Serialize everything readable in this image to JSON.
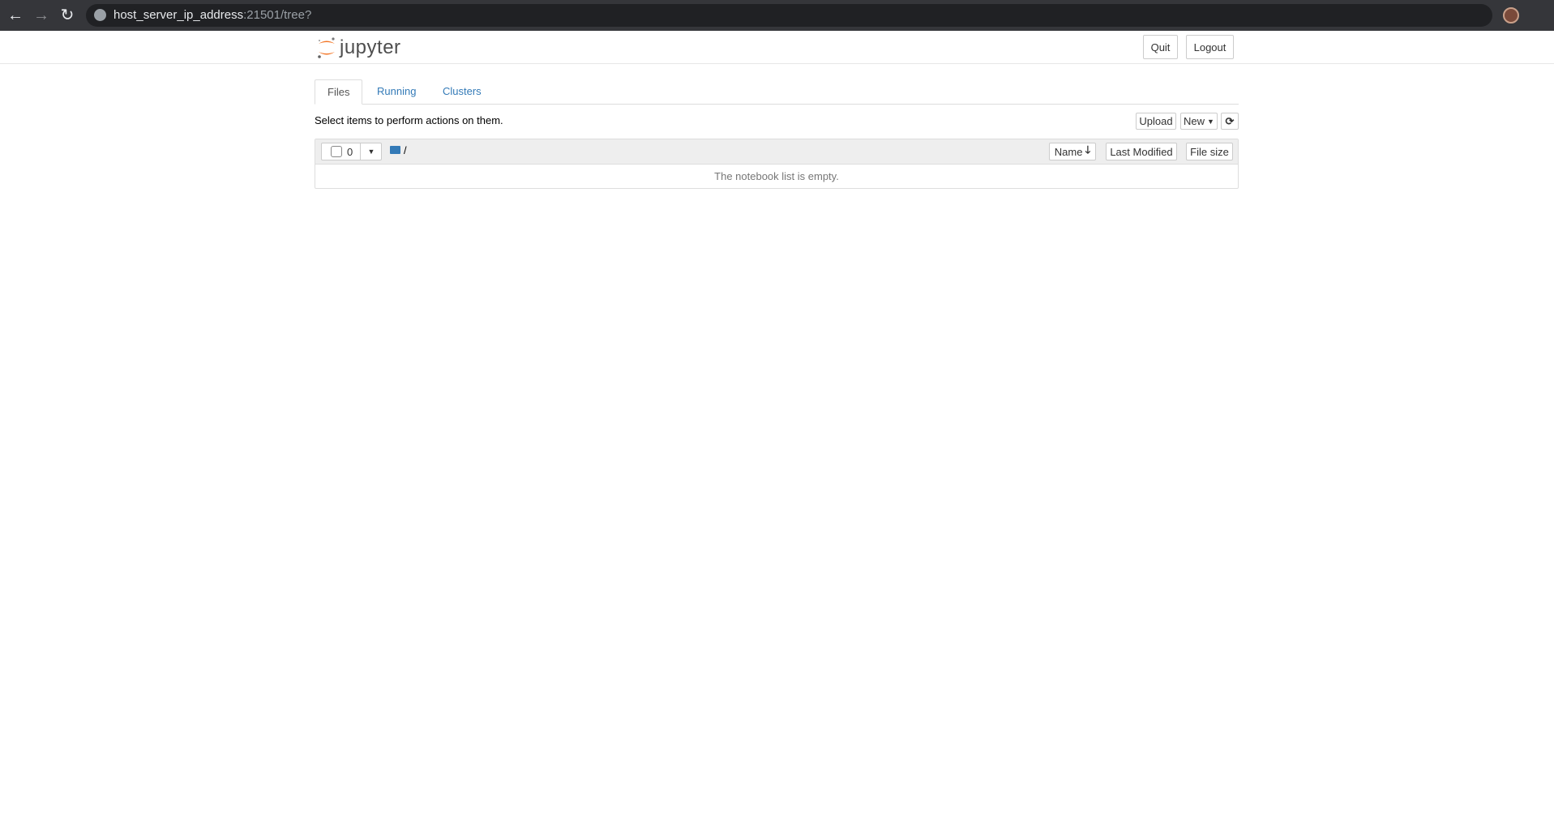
{
  "browser": {
    "url_host": "host_server_ip_address",
    "url_rest": ":21501/tree?"
  },
  "header": {
    "logo_text": "jupyter",
    "quit": "Quit",
    "logout": "Logout"
  },
  "tabs": [
    {
      "label": "Files"
    },
    {
      "label": "Running"
    },
    {
      "label": "Clusters"
    }
  ],
  "toolbar": {
    "hint": "Select items to perform actions on them.",
    "upload": "Upload",
    "new": "New",
    "refresh_icon": "refresh-icon"
  },
  "list": {
    "selected_count": "0",
    "path": "/",
    "columns": {
      "name": "Name",
      "last_modified": "Last Modified",
      "file_size": "File size"
    },
    "empty_message": "The notebook list is empty."
  },
  "colors": {
    "link": "#337ab7",
    "logo_orange": "#f37626"
  }
}
